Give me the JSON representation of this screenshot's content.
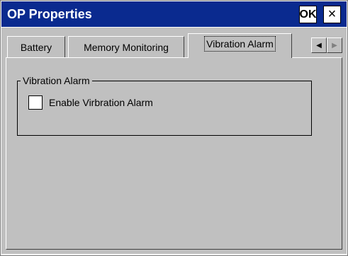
{
  "window": {
    "title": "OP Properties",
    "ok_label": "OK",
    "close_label": "×"
  },
  "tabs": [
    {
      "label": "Battery",
      "active": false
    },
    {
      "label": "Memory Monitoring",
      "active": false
    },
    {
      "label": "Vibration Alarm",
      "active": true
    }
  ],
  "tab_scroll": {
    "left_icon": "◀",
    "right_icon": "▶"
  },
  "group": {
    "label": "Vibration Alarm",
    "checkbox_label": "Enable Virbration Alarm",
    "checked": false
  },
  "colors": {
    "titlebar": "#0a2a8f",
    "face": "#c0c0c0"
  }
}
